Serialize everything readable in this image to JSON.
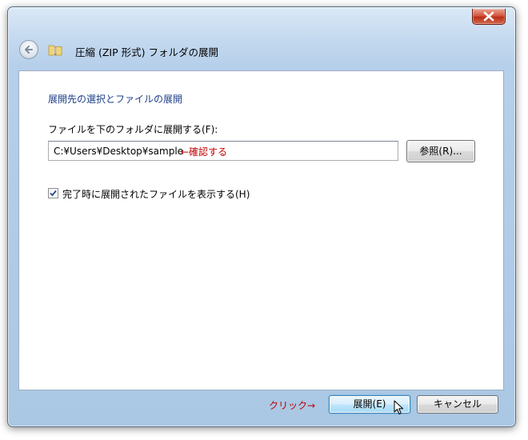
{
  "window": {
    "title": "圧縮 (ZIP 形式) フォルダの展開"
  },
  "icons": {
    "close": "close-x-icon",
    "back": "back-arrow-icon",
    "folder": "zip-folder-icon",
    "checkbox": "checkmark-icon",
    "cursor": "mouse-cursor-icon"
  },
  "content": {
    "heading": "展開先の選択とファイルの展開",
    "destination_label": "ファイルを下のフォルダに展開する(F):",
    "path_value": "C:¥Users¥Desktop¥sample",
    "confirm_note": "←確認する",
    "browse_label": "参照(R)...",
    "show_files_label": "完了時に展開されたファイルを表示する(H)",
    "show_files_checked": true
  },
  "footer": {
    "click_note": "クリック→",
    "extract_label": "展開(E)",
    "cancel_label": "キャンセル"
  },
  "colors": {
    "heading": "#1e3f8a",
    "annotation": "#c00000",
    "close_button": "#c7401f",
    "frame": "#b6cfea"
  }
}
